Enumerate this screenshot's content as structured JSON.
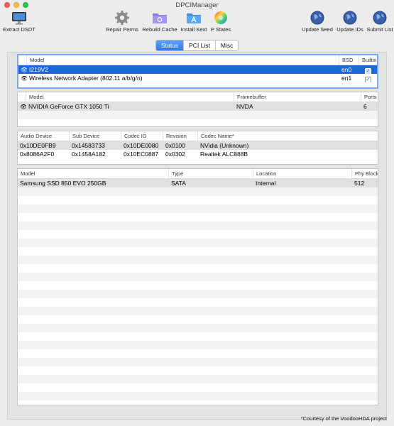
{
  "window": {
    "title": "DPCIManager"
  },
  "toolbar": {
    "extract_dsdt": "Extract DSDT",
    "repair_perms": "Repair Perms",
    "rebuild_cache": "Rebuild Cache",
    "install_kext": "Install Kext",
    "p_states": "P States",
    "update_seed": "Update Seed",
    "update_ids": "Update IDs",
    "submit_list": "Submit List"
  },
  "tabs": [
    "Status",
    "PCI List",
    "Misc"
  ],
  "network": {
    "headers": [
      "",
      "Model",
      "BSD",
      "Builtin"
    ],
    "rows": [
      {
        "model": "I219V2",
        "bsd": "en0",
        "builtin": "✓"
      },
      {
        "model": "Wireless Network Adapter (802.11 a/b/g/n)",
        "bsd": "en1",
        "builtin": "✓"
      }
    ]
  },
  "graphics": {
    "headers": [
      "",
      "Model",
      "Framebuffer",
      "Ports"
    ],
    "rows": [
      {
        "model": "NVIDIA GeForce GTX 1050 Ti",
        "framebuffer": "NVDA",
        "ports": "6"
      }
    ]
  },
  "audio": {
    "headers": [
      "Audio Device",
      "Sub Device",
      "Codec ID",
      "Revision",
      "Codec Name*"
    ],
    "rows": [
      {
        "device": "0x10DE0FB9",
        "sub": "0x14583733",
        "codec": "0x10DE0080",
        "rev": "0x0100",
        "name": "NVidia (Unknown)"
      },
      {
        "device": "0x8086A2F0",
        "sub": "0x1458A182",
        "codec": "0x10EC0887",
        "rev": "0x0302",
        "name": "Realtek ALC888B"
      }
    ]
  },
  "storage": {
    "headers": [
      "Model",
      "Type",
      "Location",
      "Phy Block"
    ],
    "rows": [
      {
        "model": "Samsung SSD 850 EVO 250GB",
        "type": "SATA",
        "location": "Internal",
        "block": "512"
      }
    ]
  },
  "footnote": "*Courtesy of the VoodooHDA project",
  "colors": {
    "selection": "#1a69d9",
    "tab_active": "#2f7ae8"
  }
}
